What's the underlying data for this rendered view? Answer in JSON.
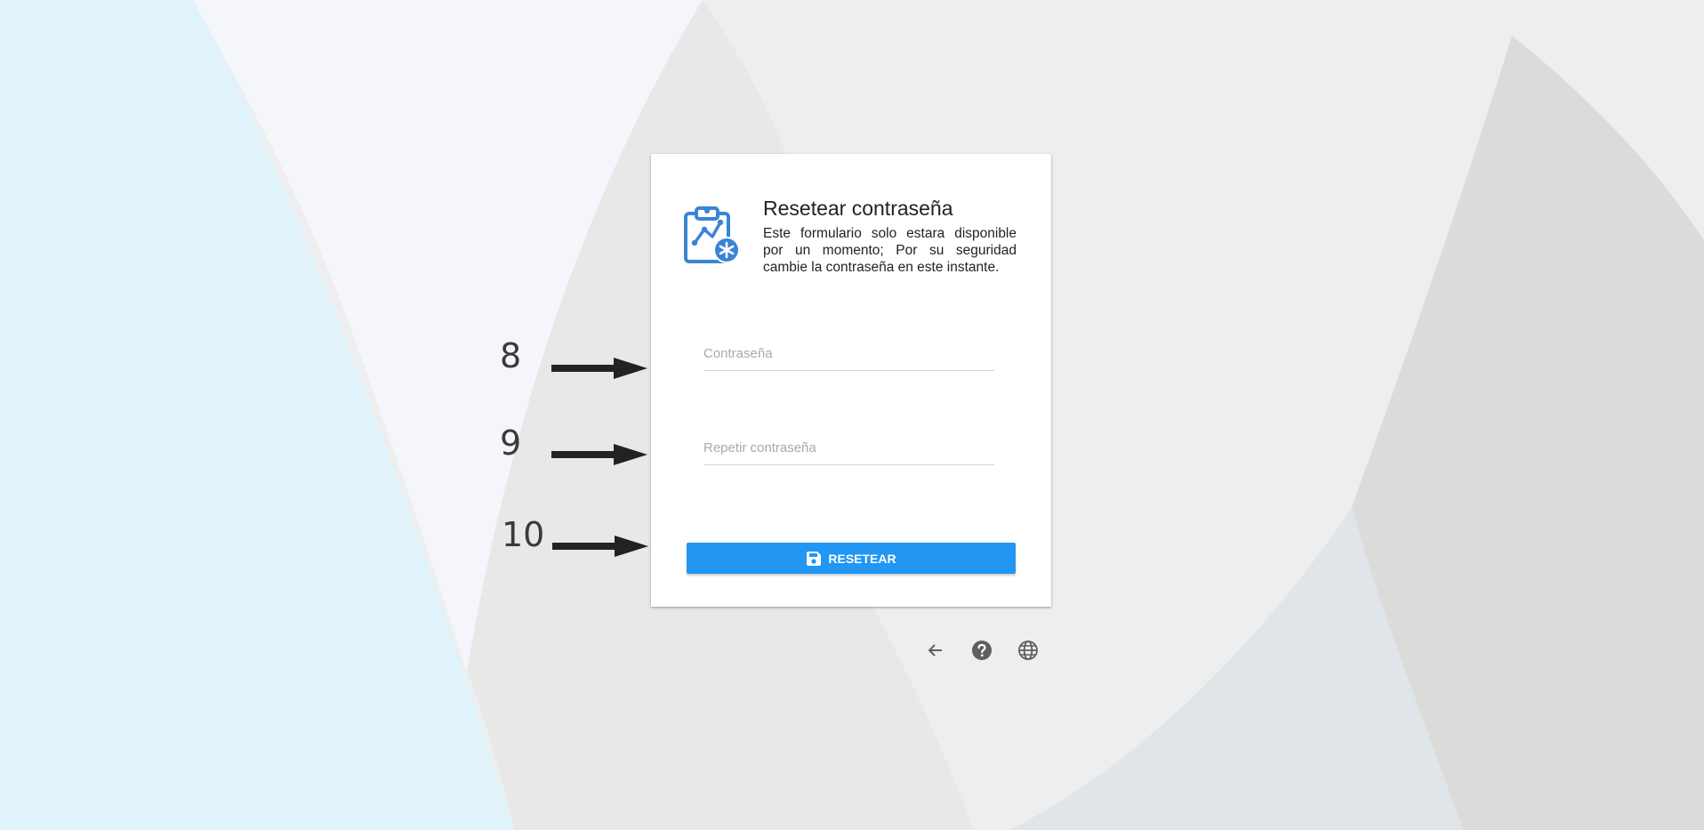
{
  "card": {
    "title": "Resetear contraseña",
    "description": "Este formulario solo estara disponible por un momento; Por su seguridad cambie la contraseña en este instante."
  },
  "form": {
    "password_placeholder": "Contraseña",
    "repeat_password_placeholder": "Repetir contraseña",
    "reset_label": "RESETEAR"
  },
  "footer": {
    "icons": [
      "arrow-left-icon",
      "help-icon",
      "globe-icon"
    ]
  },
  "annotations": {
    "labels": [
      "8",
      "9",
      "10"
    ]
  },
  "colors": {
    "accent": "#2196f3",
    "logo": "#3a85d4"
  }
}
